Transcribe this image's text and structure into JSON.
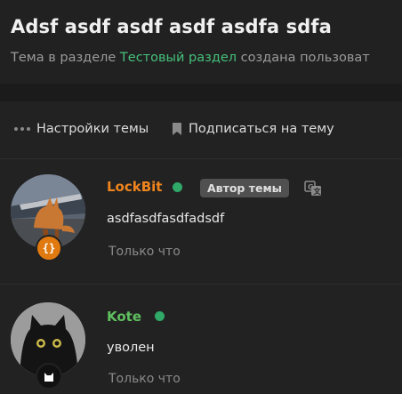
{
  "thread": {
    "title": "Adsf asdf asdf asdf asdfa sdfa",
    "subtitle_prefix": "Тема в разделе ",
    "section_link": "Тестовый раздел",
    "subtitle_suffix": " создана пользоват"
  },
  "toolbar": {
    "settings_label": "Настройки темы",
    "subscribe_label": "Подписаться на тему"
  },
  "posts": [
    {
      "username": "LockBit",
      "username_color": "#f0851e",
      "badge": "Автор темы",
      "message": "asdfasdfasdfadsdf",
      "time": "Только что",
      "avatar_badge_icon": "curly-braces-icon",
      "avatar_badge_color": "#e07a10"
    },
    {
      "username": "Kote",
      "username_color": "#5fc05f",
      "message": "уволен",
      "time": "Только что",
      "avatar_badge_icon": "cat-icon",
      "avatar_badge_color": "#111111"
    }
  ],
  "colors": {
    "accent_link": "#45c07a",
    "online": "#2fa868",
    "background": "#1f1f1f"
  }
}
